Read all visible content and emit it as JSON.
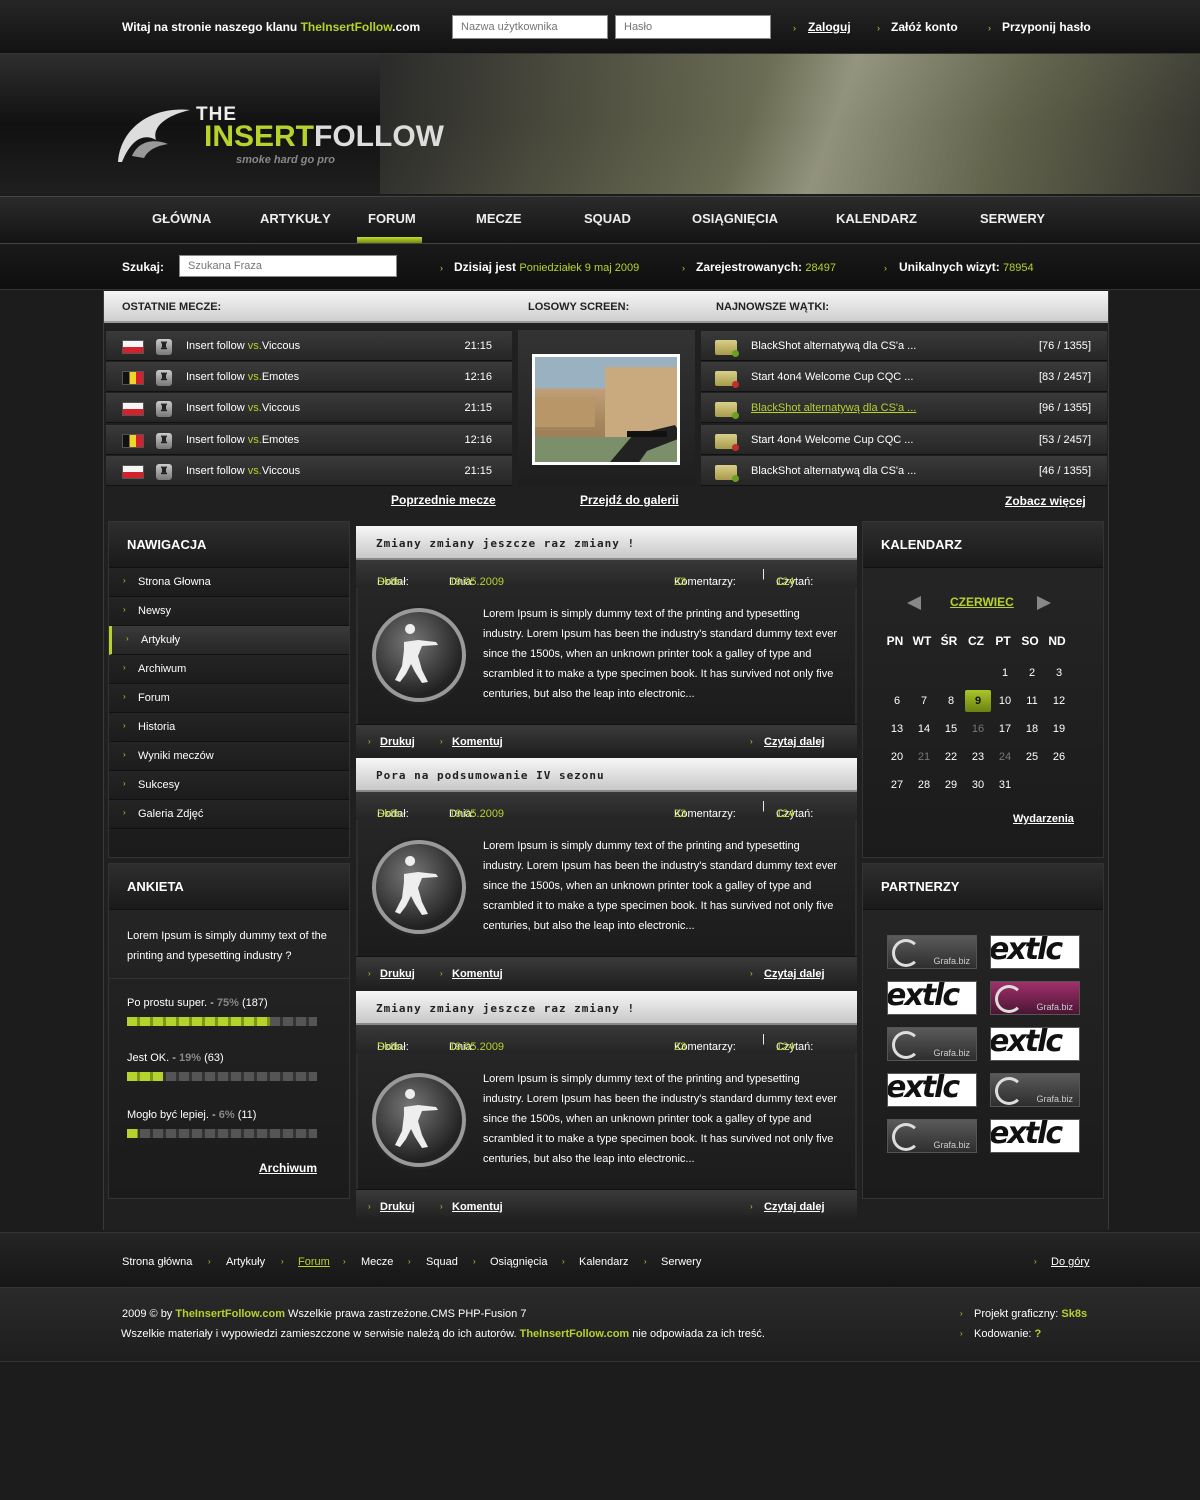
{
  "topbar": {
    "welcome_prefix": "Witaj na stronie naszego klanu ",
    "welcome_site": "TheInsertFollow",
    "welcome_suffix": ".com",
    "username_placeholder": "Nazwa użytkownika",
    "password_placeholder": "Hasło",
    "login": "Zaloguj",
    "register": "Załóż konto",
    "remind": "Przyponij hasło"
  },
  "logo": {
    "the": "THE",
    "main_a": "INSERT",
    "main_b": "FOLLOW",
    "tagline": "smoke hard go pro"
  },
  "nav": [
    "GŁÓWNA",
    "ARTYKUŁY",
    "FORUM",
    "MECZE",
    "SQUAD",
    "OSIĄGNIĘCIA",
    "KALENDARZ",
    "SERWERY"
  ],
  "searchbar": {
    "label": "Szukaj:",
    "placeholder": "Szukana Fraza",
    "today_label": "Dzisiaj jest",
    "today_value": "Poniedziałek 9 maj 2009",
    "registered_label": "Zarejestrowanych:",
    "registered_value": "28497",
    "visits_label": "Unikalnych wizyt:",
    "visits_value": "78954"
  },
  "sections": {
    "matches": "OSTATNIE MECZE:",
    "screen": "LOSOWY SCREEN:",
    "threads": "NAJNOWSZE WĄTKI:"
  },
  "matches": [
    {
      "flag": "pl",
      "team": "Insert follow",
      "vs": "vs.",
      "opponent": "Viccous",
      "time": "21:15"
    },
    {
      "flag": "be",
      "team": "Insert follow",
      "vs": "vs.",
      "opponent": "Emotes",
      "time": "12:16"
    },
    {
      "flag": "pl",
      "team": "Insert follow",
      "vs": "vs.",
      "opponent": "Viccous",
      "time": "21:15"
    },
    {
      "flag": "be",
      "team": "Insert follow",
      "vs": "vs.",
      "opponent": "Emotes",
      "time": "12:16"
    },
    {
      "flag": "pl",
      "team": "Insert follow",
      "vs": "vs.",
      "opponent": "Viccous",
      "time": "21:15"
    }
  ],
  "threads": [
    {
      "title": "BlackShot alternatywą dla CS'a ...",
      "a": "76",
      "b": "1355",
      "status": "green"
    },
    {
      "title": "Start 4on4 Welcome Cup CQC ...",
      "a": "83",
      "b": "2457",
      "status": "red"
    },
    {
      "title": "BlackShot alternatywą dla CS'a ...",
      "a": "96",
      "b": "1355",
      "status": "green",
      "highlight": true
    },
    {
      "title": "Start 4on4 Welcome Cup CQC ...",
      "a": "53",
      "b": "2457",
      "status": "red"
    },
    {
      "title": "BlackShot alternatywą dla CS'a ...",
      "a": "46",
      "b": "1355",
      "status": "green"
    }
  ],
  "links": {
    "prev_matches": "Poprzednie mecze",
    "gallery": "Przejdź do galerii",
    "more": "Zobacz więcej"
  },
  "navigation": {
    "title": "NAWIGACJA",
    "items": [
      "Strona Głowna",
      "Newsy",
      "Artykuły",
      "Archiwum",
      "Forum",
      "Historia",
      "Wyniki meczów",
      "Sukcesy",
      "Galeria Zdjęć"
    ],
    "active": 2
  },
  "poll": {
    "title": "ANKIETA",
    "question": "Lorem Ipsum is simply dummy text of the printing and typesetting industry ?",
    "options": [
      {
        "label": "Po prostu super. - ",
        "pct": "75%",
        "count": "(187)",
        "fill": 0.75
      },
      {
        "label": "Jest OK. - ",
        "pct": "19%",
        "count": "(63)",
        "fill": 0.19
      },
      {
        "label": "Mogło być lepiej. - ",
        "pct": "6%",
        "count": "(11)",
        "fill": 0.06
      }
    ],
    "archive": "Archiwum"
  },
  "articles": [
    {
      "title": "Zmiany zmiany jeszcze raz zmiany !",
      "author_label": "Dodał:",
      "author": "Sk8s",
      "date_label": "Dnia:",
      "date": "19.05.2009",
      "comments_label": "Komentarzy:",
      "comments": "23",
      "reads_label": "Czytań:",
      "reads": "124",
      "body": "Lorem Ipsum is simply dummy text of the printing and typesetting industry. Lorem Ipsum has been the industry's standard dummy text ever since the 1500s, when an unknown printer took a galley of type and scrambled it to make a type specimen book. It has survived not only five centuries, but also the leap into electronic...",
      "print": "Drukuj",
      "comment": "Komentuj",
      "readmore": "Czytaj dalej"
    },
    {
      "title": "Pora na podsumowanie IV sezonu",
      "author_label": "Dodał:",
      "author": "Sk8s",
      "date_label": "Dnia:",
      "date": "19.05.2009",
      "comments_label": "Komentarzy:",
      "comments": "23",
      "reads_label": "Czytań:",
      "reads": "124",
      "body": "Lorem Ipsum is simply dummy text of the printing and typesetting industry. Lorem Ipsum has been the industry's standard dummy text ever since the 1500s, when an unknown printer took a galley of type and scrambled it to make a type specimen book. It has survived not only five centuries, but also the leap into electronic...",
      "print": "Drukuj",
      "comment": "Komentuj",
      "readmore": "Czytaj dalej"
    },
    {
      "title": "Zmiany zmiany jeszcze raz zmiany !",
      "author_label": "Dodał:",
      "author": "Sk8s",
      "date_label": "Dnia:",
      "date": "19.05.2009",
      "comments_label": "Komentarzy:",
      "comments": "23",
      "reads_label": "Czytań:",
      "reads": "124",
      "body": "Lorem Ipsum is simply dummy text of the printing and typesetting industry. Lorem Ipsum has been the industry's standard dummy text ever since the 1500s, when an unknown printer took a galley of type and scrambled it to make a type specimen book. It has survived not only five centuries, but also the leap into electronic...",
      "print": "Drukuj",
      "comment": "Komentuj",
      "readmore": "Czytaj dalej"
    }
  ],
  "calendar": {
    "title": "KALENDARZ",
    "month": "CZERWIEC",
    "days": [
      "PN",
      "WT",
      "ŚR",
      "CZ",
      "PT",
      "SO",
      "ND"
    ],
    "weeks": [
      [
        "",
        "",
        "",
        "",
        "1",
        "2",
        "3"
      ],
      [
        "6",
        "7",
        "8",
        "9",
        "10",
        "11",
        "12"
      ],
      [
        "13",
        "14",
        "15",
        "16",
        "17",
        "18",
        "19"
      ],
      [
        "20",
        "21",
        "22",
        "23",
        "24",
        "25",
        "26"
      ],
      [
        "27",
        "28",
        "29",
        "30",
        "31",
        "",
        ""
      ]
    ],
    "today": "9",
    "dimmed": [
      "16",
      "21",
      "24"
    ],
    "events": "Wydarzenia"
  },
  "partners": {
    "title": "PARTNERZY",
    "logos": [
      {
        "kind": "grafa",
        "text": "Grafa.biz"
      },
      {
        "kind": "ext",
        "text": "extlc am."
      },
      {
        "kind": "ext",
        "text": "extlc am."
      },
      {
        "kind": "grafa-pink",
        "text": "Grafa.biz"
      },
      {
        "kind": "grafa",
        "text": "Grafa.biz"
      },
      {
        "kind": "ext",
        "text": "extlc am."
      },
      {
        "kind": "ext",
        "text": "extlc am."
      },
      {
        "kind": "grafa",
        "text": "Grafa.biz"
      },
      {
        "kind": "grafa",
        "text": "Grafa.biz"
      },
      {
        "kind": "ext",
        "text": "extlc am."
      }
    ]
  },
  "footer_nav": {
    "items": [
      "Strona główna",
      "Artykuły",
      "Forum",
      "Mecze",
      "Squad",
      "Osiągnięcia",
      "Kalendarz",
      "Serwery"
    ],
    "active": 2,
    "top": "Do góry"
  },
  "footer": {
    "line1_a": "2009 © by ",
    "line1_site": "TheInsertFollow.com",
    "line1_b": " Wszelkie prawa zastrzeżone.CMS PHP-Fusion 7",
    "line2_a": "Wszelkie materiały i wypowiedzi zamieszczone w serwisie należą do ich autorów. ",
    "line2_site": "TheInsertFollow.com",
    "line2_b": " nie odpowiada za ich treść.",
    "design_label": "Projekt graficzny: ",
    "design_value": "Sk8s",
    "code_label": "Kodowanie: ",
    "code_value": "?"
  },
  "colors": {
    "accent": "#b6d22c",
    "background": "#1c1c1c"
  }
}
